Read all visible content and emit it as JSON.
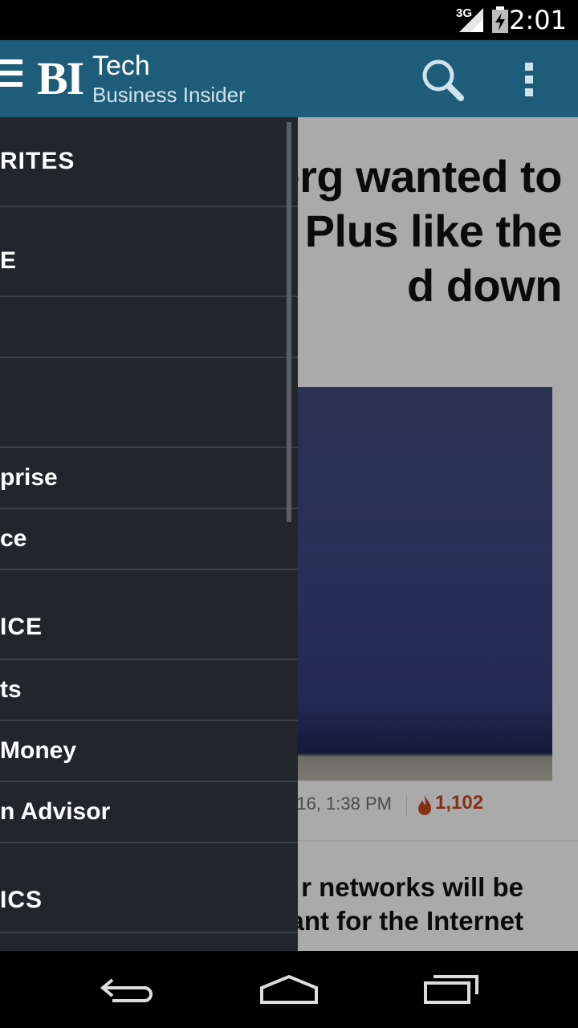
{
  "status_bar": {
    "network": "3G",
    "time": "2:01"
  },
  "action_bar": {
    "logo": "BI",
    "title": "Tech",
    "subtitle": "Business Insider"
  },
  "article": {
    "headline": "erg wanted to\ne Plus like the\nd down",
    "meta_date": "16, 1:38 PM",
    "hot_count": "1,102",
    "second_headline": "r networks will be\nant for the Internet"
  },
  "drawer": {
    "items": [
      {
        "label": "RITES",
        "type": "section"
      },
      {
        "label": "E",
        "type": "item"
      },
      {
        "label": "",
        "type": "item"
      },
      {
        "label": "",
        "type": "item"
      },
      {
        "label": "prise",
        "type": "item"
      },
      {
        "label": "ce",
        "type": "item"
      },
      {
        "label": "ICE",
        "type": "section"
      },
      {
        "label": "ts",
        "type": "item"
      },
      {
        "label": "Money",
        "type": "item"
      },
      {
        "label": "n Advisor",
        "type": "item"
      },
      {
        "label": "ICS",
        "type": "section"
      }
    ]
  },
  "colors": {
    "action_bar": "#1e5d7a",
    "drawer_bg": "#22262b",
    "hot_accent": "#c0451d"
  },
  "icons": [
    "menu-icon",
    "search-icon",
    "overflow-menu-icon",
    "fire-icon",
    "back-icon",
    "home-icon",
    "recents-icon",
    "signal-icon",
    "battery-icon"
  ]
}
